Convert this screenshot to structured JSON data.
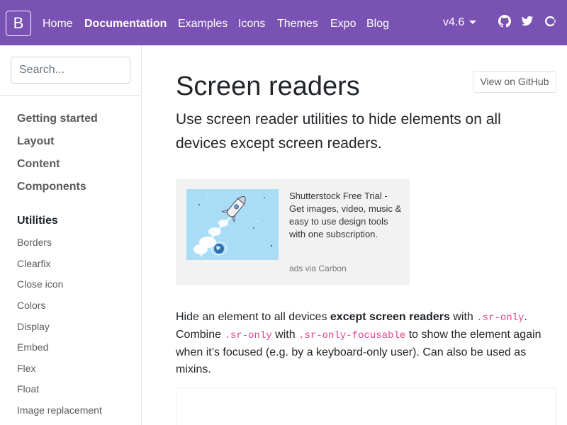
{
  "navbar": {
    "brand": "B",
    "links": [
      {
        "label": "Home"
      },
      {
        "label": "Documentation"
      },
      {
        "label": "Examples"
      },
      {
        "label": "Icons"
      },
      {
        "label": "Themes"
      },
      {
        "label": "Expo"
      },
      {
        "label": "Blog"
      }
    ],
    "version": "v4.6",
    "icons": [
      "github-icon",
      "twitter-icon",
      "opencollective-icon"
    ]
  },
  "sidebar": {
    "search": {
      "placeholder": "Search..."
    },
    "sections": [
      {
        "label": "Getting started"
      },
      {
        "label": "Layout"
      },
      {
        "label": "Content"
      },
      {
        "label": "Components"
      },
      {
        "label": "Utilities"
      }
    ],
    "utilities_items": [
      {
        "label": "Borders"
      },
      {
        "label": "Clearfix"
      },
      {
        "label": "Close icon"
      },
      {
        "label": "Colors"
      },
      {
        "label": "Display"
      },
      {
        "label": "Embed"
      },
      {
        "label": "Flex"
      },
      {
        "label": "Float"
      },
      {
        "label": "Image replacement"
      }
    ]
  },
  "main": {
    "title": "Screen readers",
    "github_button": "View on GitHub",
    "lead": "Use screen reader utilities to hide elements on all devices except screen readers.",
    "carbon": {
      "text": "Shutterstock Free Trial - Get images, video, music & easy to use design tools with one subscription.",
      "powered_by": "ads via Carbon"
    },
    "body": {
      "part1": "Hide an element to all devices ",
      "strong": "except screen readers",
      "part2": " with ",
      "code1": ".sr-only",
      "part3": ". Combine ",
      "code2": ".sr-only",
      "part4": " with ",
      "code3": ".sr-only-focusable",
      "part5": " to show the element again when it’s focused (e.g. by a keyboard-only user). Can also be used as mixins."
    }
  },
  "colors": {
    "brand": "#7952b3",
    "code": "#e83e8c"
  }
}
